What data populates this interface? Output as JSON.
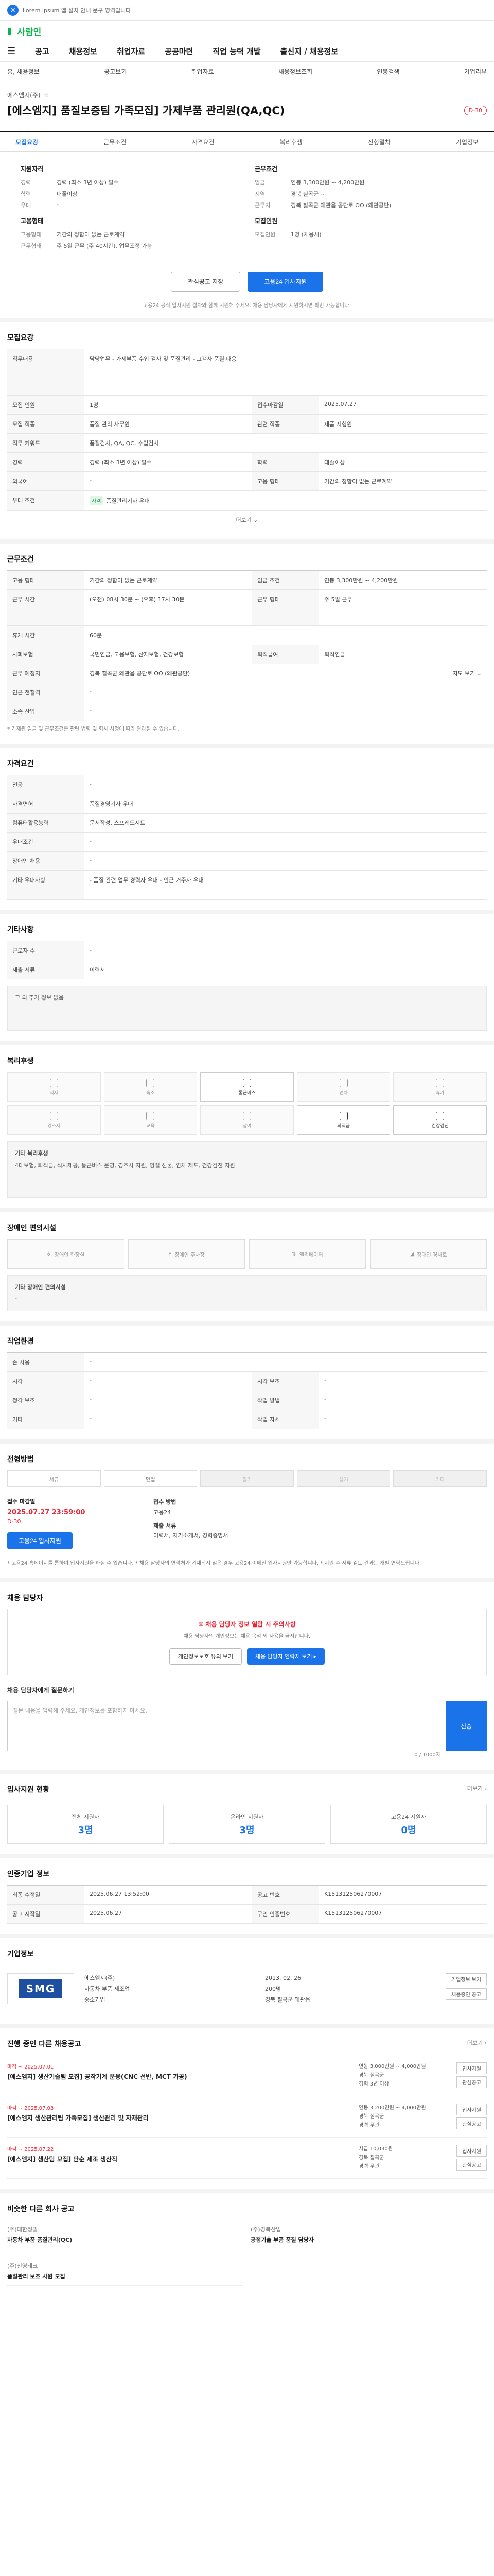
{
  "topbar": {
    "text": "Lorem ipsum 앱 설치 안내 문구 영역입니다"
  },
  "logo": {
    "mark": "▮",
    "text": "사람인"
  },
  "gnb": {
    "menu_icon": "☰",
    "items": [
      "공고",
      "채용정보",
      "취업자료",
      "공공마련",
      "직업 능력 개발",
      "출신지 / 채용정보"
    ]
  },
  "subnav": [
    "홈, 채용정보",
    "공고보기",
    "취업자료",
    "채용정보조회",
    "연봉검색",
    "기업리뷰"
  ],
  "header": {
    "company": "에스엠지(주)",
    "title": "[에스엠지] 품질보증팀 가족모집] 가제부품 관리원(QA,QC)",
    "dday": "D-30"
  },
  "tabs": [
    "모집요강",
    "근무조건",
    "자격요건",
    "복리후생",
    "전형절차",
    "기업정보"
  ],
  "summary": {
    "left_title": "지원자격",
    "left_rows": [
      {
        "k": "경력",
        "v": "경력 (최소 3년 이상) 필수"
      },
      {
        "k": "학력",
        "v": "대졸이상"
      },
      {
        "k": "우대",
        "v": "-"
      }
    ],
    "left_title2": "고용형태",
    "left_rows2": [
      {
        "k": "고용형태",
        "v": "기간의 정함이 없는 근로계약"
      },
      {
        "k": "근무형태",
        "v": "주 5일 근무 (주 40시간), 업무조정 가능"
      }
    ],
    "right_title": "근무조건",
    "right_rows": [
      {
        "k": "임금",
        "v": "연봉 3,300만원 ~ 4,200만원"
      },
      {
        "k": "지역",
        "v": "경북 칠곡군 ~"
      },
      {
        "k": "근무처",
        "v": "경북 칠곡군 왜관읍 공단로 OO (왜관공단)"
      }
    ],
    "right_title2": "모집인원",
    "right_rows2": [
      {
        "k": "모집인원",
        "v": "1명 (채용시)"
      }
    ]
  },
  "actions": {
    "save": "관심공고 저장",
    "apply": "고용24 입사지원"
  },
  "summary_note": "고용24 공식 입사지원 절차와 함께 지원해 주세요. 채용 담당자에게 지원하시면 확인 가능합니다.",
  "recruit": {
    "title": "모집요강",
    "rows": [
      {
        "th": "직무내용",
        "td": "담당업무 - 가제부품 수입 검사 및 품질관리 - 고객사 품질 대응"
      },
      {
        "th": "모집 인원",
        "td": "1명",
        "th2": "접수마감일",
        "td2": "2025.07.27"
      },
      {
        "th": "모집 직종",
        "td": "품질 관리 사무원",
        "th2": "관련 직종",
        "td2": "제품 시험원"
      },
      {
        "th": "직무 키워드",
        "td": "품질검사, QA, QC, 수입검사"
      },
      {
        "th": "경력",
        "td": "경력 (최소 3년 이상) 필수",
        "th2": "학력",
        "td2": "대졸이상"
      },
      {
        "th": "외국어",
        "td": "-",
        "th2": "고용 형태",
        "td2": "기간의 정함이 없는 근로계약"
      },
      {
        "th": "우대 조건",
        "td": "품질관리기사 우대",
        "tag": "자격"
      }
    ],
    "more": "더보기 ⌄"
  },
  "conditions": {
    "title": "근무조건",
    "rows": [
      {
        "th": "고용 형태",
        "td": "기간의 정함이 없는 근로계약",
        "th2": "임금 조건",
        "td2": "연봉 3,300만원 ~ 4,200만원"
      },
      {
        "th": "근무 시간",
        "td": "(오전) 08시 30분 ~ (오후) 17시 30분",
        "th2": "근무 형태",
        "td2": "주 5일 근무"
      },
      {
        "th": "휴게 시간",
        "td": "60분"
      },
      {
        "th": "사회보험",
        "td": "국민연금, 고용보험, 산재보험, 건강보험",
        "th2": "퇴직급여",
        "td2": "퇴직연금"
      },
      {
        "th": "근무 예정지",
        "td": "경북 칠곡군 왜관읍 공단로 OO (왜관공단)",
        "link": "지도 보기 ⌄"
      },
      {
        "th": "인근 전철역",
        "td": "-"
      },
      {
        "th": "소속 산업",
        "td": "-"
      }
    ],
    "note": "* 기재된 임금 및 근무조건은 관련 법령 및 회사 사정에 따라 달라질 수 있습니다."
  },
  "qualify": {
    "title": "자격요건",
    "rows": [
      {
        "th": "전공",
        "td": "-"
      },
      {
        "th": "자격면허",
        "td": "품질경영기사 우대"
      },
      {
        "th": "컴퓨터활용능력",
        "td": "문서작성, 스프레드시트"
      },
      {
        "th": "우대조건",
        "td": "-"
      },
      {
        "th": "장애인 채용",
        "td": "-"
      },
      {
        "th": "기타 우대사항",
        "td": "- 품질 관련 업무 경력자 우대 - 인근 거주자 우대"
      }
    ]
  },
  "extra": {
    "title": "기타사항",
    "rows": [
      {
        "th": "근로자 수",
        "td": "-"
      },
      {
        "th": "제출 서류",
        "td": "이력서"
      }
    ],
    "box": "그 외 추가 정보 없음"
  },
  "benefit": {
    "title": "복리후생",
    "items": [
      {
        "label": "식사",
        "active": false
      },
      {
        "label": "숙소",
        "active": false
      },
      {
        "label": "통근버스",
        "active": true
      },
      {
        "label": "연차",
        "active": false
      },
      {
        "label": "휴가",
        "active": false
      },
      {
        "label": "경조사",
        "active": false
      },
      {
        "label": "교육",
        "active": false
      },
      {
        "label": "상여",
        "active": false
      },
      {
        "label": "퇴직금",
        "active": true
      },
      {
        "label": "건강검진",
        "active": true
      }
    ],
    "other_title": "기타 복리후생",
    "other_text": "4대보험, 퇴직금, 식사제공, 통근버스 운영, 경조사 지원, 명절 선물, 연차 제도, 건강검진 지원"
  },
  "disability": {
    "title": "장애인 편의시설",
    "items": [
      "장애인 화장실",
      "장애인 주차장",
      "엘리베이터",
      "장애인 경사로"
    ],
    "other_title": "기타 장애인 편의시설",
    "other_text": "-"
  },
  "workplace": {
    "title": "작업환경",
    "rows": [
      {
        "th": "손 사용",
        "td": "-",
        "th2": "",
        "td2": ""
      },
      {
        "th": "시각",
        "td": "-",
        "th2": "시각 보조",
        "td2": "-"
      },
      {
        "th": "청각 보조",
        "td": "-",
        "th2": "작업 방법",
        "td2": "-"
      },
      {
        "th": "기타",
        "td": "-",
        "th2": "작업 자세",
        "td2": "-"
      }
    ]
  },
  "process": {
    "title": "전형방법",
    "steps": [
      {
        "label": "서류",
        "dim": false
      },
      {
        "label": "면접",
        "dim": false
      },
      {
        "label": "필기",
        "dim": true
      },
      {
        "label": "실기",
        "dim": true
      },
      {
        "label": "기타",
        "dim": true
      }
    ]
  },
  "apply": {
    "deadline_label": "접수 마감일",
    "deadline": "2025.07.27 23:59:00",
    "dday": "D-30",
    "method_label": "접수 방법",
    "method": "고용24",
    "docs_label": "제출 서류",
    "docs": "이력서, 자기소개서, 경력증명서",
    "button": "고용24 입사지원",
    "notes": "* 고용24 홈페이지를 통하여 입사지원을 하실 수 있습니다. * 채용 담당자의 연락처가 기재되지 않은 경우 고용24 이메일 입사지원만 가능합니다. * 지원 후 서류 검토 결과는 개별 연락드립니다."
  },
  "contact": {
    "title": "채용 담당자",
    "notice": "✉ 채용 담당자 정보 열람 시 주의사항",
    "notice_text": "채용 담당자의 개인정보는 채용 목적 외 사용을 금지합니다.",
    "btn1": "개인정보보호 유의 보기",
    "btn2": "채용 담당자 연락처 보기 ▸"
  },
  "chat": {
    "title": "채용 담당자에게 질문하기",
    "placeholder": "질문 내용을 입력해 주세요. 개인정보를 포함하지 마세요.",
    "button": "전송",
    "counter": "0 / 1000자"
  },
  "status": {
    "title": "입사지원 현황",
    "link": "더보기 ›",
    "stats": [
      {
        "label": "전체 지원자",
        "value": "3명"
      },
      {
        "label": "온라인 지원자",
        "value": "3명"
      },
      {
        "label": "고용24 지원자",
        "value": "0명"
      }
    ]
  },
  "info": {
    "title": "인증기업 정보",
    "rows": [
      {
        "th": "최종 수정일",
        "td": "2025.06.27 13:52:00",
        "th2": "공고 번호",
        "td2": "K151312506270007"
      },
      {
        "th": "공고 시작일",
        "td": "2025.06.27",
        "th2": "구인 인증번호",
        "td2": "K151312506270007"
      }
    ]
  },
  "company": {
    "title": "기업정보",
    "logo": "SMG",
    "name": "에스엠지(주)",
    "industry": "자동차 부품 제조업",
    "size": "중소기업",
    "founded": "2013. 02. 26",
    "employees": "200명",
    "address": "경북 칠곡군 왜관읍",
    "btn1": "기업정보 보기",
    "btn2": "채용중인 공고"
  },
  "other_jobs": {
    "title": "진행 중인 다른 채용공고",
    "link": "더보기 ›",
    "items": [
      {
        "date": "마감 ~ 2025.07.01",
        "title": "[에스엠지] 생산기술팀 모집] 공작기계 운용(CNC 선반, MCT 가공)",
        "pay": "연봉 3,000만원 ~ 4,000만원",
        "place": "경북 칠곡군",
        "cond": "경력 3년 이상"
      },
      {
        "date": "마감 ~ 2025.07.03",
        "title": "[에스엠지 생산관리팀 가족모집] 생산관리 및 자재관리",
        "pay": "연봉 3,200만원 ~ 4,000만원",
        "place": "경북 칠곡군",
        "cond": "경력 무관"
      },
      {
        "date": "마감 ~ 2025.07.22",
        "title": "[에스엠지] 생산팀 모집] 단순 제조 생산직",
        "pay": "시급 10,030원",
        "place": "경북 칠곡군",
        "cond": "경력 무관"
      }
    ],
    "btn_apply": "입사지원",
    "btn_save": "관심공고"
  },
  "similar": {
    "title": "비슷한 다른 회사 공고",
    "items": [
      {
        "company": "(주)대한정밀",
        "title": "자동차 부품 품질관리(QC)"
      },
      {
        "company": "(주)경북산업",
        "title": "공정기술 부품 품질 담당자"
      },
      {
        "company": "(주)신영테크",
        "title": "품질관리 보조 사원 모집"
      }
    ]
  }
}
